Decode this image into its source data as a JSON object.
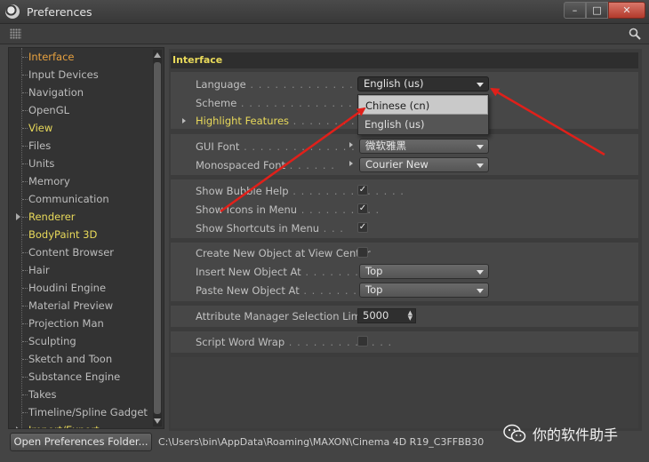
{
  "window": {
    "title": "Preferences",
    "controls": [
      "–",
      "□",
      "✕"
    ]
  },
  "sidebar": {
    "items": [
      {
        "label": "Interface",
        "state": "active"
      },
      {
        "label": "Input Devices",
        "state": ""
      },
      {
        "label": "Navigation",
        "state": ""
      },
      {
        "label": "OpenGL",
        "state": ""
      },
      {
        "label": "View",
        "state": "hl"
      },
      {
        "label": "Files",
        "state": ""
      },
      {
        "label": "Units",
        "state": ""
      },
      {
        "label": "Memory",
        "state": ""
      },
      {
        "label": "Communication",
        "state": ""
      },
      {
        "label": "Renderer",
        "state": "hl",
        "expandable": true
      },
      {
        "label": "BodyPaint 3D",
        "state": "hl"
      },
      {
        "label": "Content Browser",
        "state": ""
      },
      {
        "label": "Hair",
        "state": ""
      },
      {
        "label": "Houdini Engine",
        "state": ""
      },
      {
        "label": "Material Preview",
        "state": ""
      },
      {
        "label": "Projection Man",
        "state": ""
      },
      {
        "label": "Sculpting",
        "state": ""
      },
      {
        "label": "Sketch and Toon",
        "state": ""
      },
      {
        "label": "Substance Engine",
        "state": ""
      },
      {
        "label": "Takes",
        "state": ""
      },
      {
        "label": "Timeline/Spline Gadget",
        "state": ""
      },
      {
        "label": "Import/Export",
        "state": "hl",
        "expandable": true
      }
    ]
  },
  "main": {
    "section_title": "Interface",
    "language": {
      "label": "Language",
      "value": "English (us)"
    },
    "scheme": {
      "label": "Scheme"
    },
    "highlight_features": {
      "label": "Highlight Features"
    },
    "language_popup": {
      "options": [
        "Chinese (cn)",
        "English (us)"
      ]
    },
    "gui_font": {
      "label": "GUI Font",
      "value": "微软雅黑"
    },
    "mono_font": {
      "label": "Monospaced Font",
      "value": "Courier New"
    },
    "bubble_help": {
      "label": "Show Bubble Help",
      "checked": "✓"
    },
    "icons_in_menu": {
      "label": "Show Icons in Menu",
      "checked": "✓"
    },
    "shortcuts_in_menu": {
      "label": "Show Shortcuts in Menu",
      "checked": "✓"
    },
    "create_at_center": {
      "label": "Create New Object at View Center",
      "checked": ""
    },
    "insert_at": {
      "label": "Insert New Object At",
      "value": "Top"
    },
    "paste_at": {
      "label": "Paste New Object At",
      "value": "Top"
    },
    "am_limit": {
      "label": "Attribute Manager Selection Limit",
      "value": "5000"
    },
    "word_wrap": {
      "label": "Script Word Wrap",
      "checked": ""
    }
  },
  "footer": {
    "open_button": "Open Preferences Folder...",
    "path": "C:\\Users\\bin\\AppData\\Roaming\\MAXON\\Cinema 4D R19_C3FFBB30"
  },
  "watermark": {
    "text": "你的软件助手"
  },
  "colors": {
    "active": "#e8a240",
    "highlight": "#e8d95a",
    "annotation_arrow": "#e0201a"
  }
}
